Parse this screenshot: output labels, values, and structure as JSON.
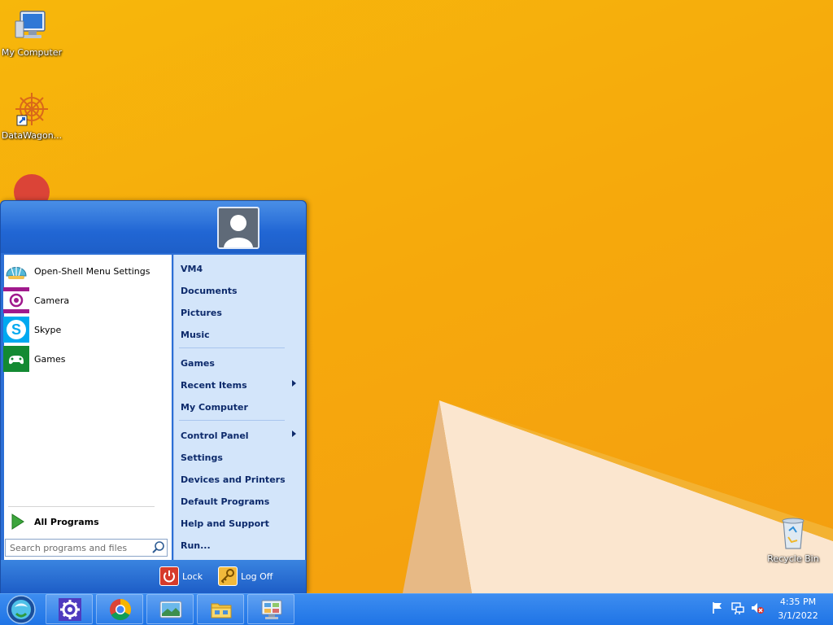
{
  "desktop": {
    "icons": [
      {
        "label": "My Computer"
      },
      {
        "label": "DataWagon..."
      },
      {
        "label": "Recycle Bin"
      }
    ]
  },
  "start_menu": {
    "pinned": [
      {
        "label": "Open-Shell Menu Settings",
        "icon": "shell-icon"
      },
      {
        "label": "Camera",
        "icon": "camera-icon"
      },
      {
        "label": "Skype",
        "icon": "skype-icon"
      },
      {
        "label": "Games",
        "icon": "games-icon"
      }
    ],
    "all_programs": "All Programs",
    "search_placeholder": "Search programs and files",
    "right_items": [
      {
        "label": "VM4"
      },
      {
        "label": "Documents"
      },
      {
        "label": "Pictures"
      },
      {
        "label": "Music"
      },
      {
        "label": "Games"
      },
      {
        "label": "Recent Items"
      },
      {
        "label": "My Computer"
      },
      {
        "label": "Control Panel"
      },
      {
        "label": "Settings"
      },
      {
        "label": "Devices and Printers"
      },
      {
        "label": "Default Programs"
      },
      {
        "label": "Help and Support"
      },
      {
        "label": "Run..."
      }
    ],
    "footer": {
      "lock": "Lock",
      "logoff": "Log Off"
    }
  },
  "taskbar": {
    "clock_time": "4:35 PM",
    "clock_date": "3/1/2022"
  },
  "colors": {
    "wallpaper": "#f6a90c",
    "menu_blue": "#2c6fd6",
    "right_pane": "#d3e5fa",
    "taskbar": "#1f74e6"
  }
}
